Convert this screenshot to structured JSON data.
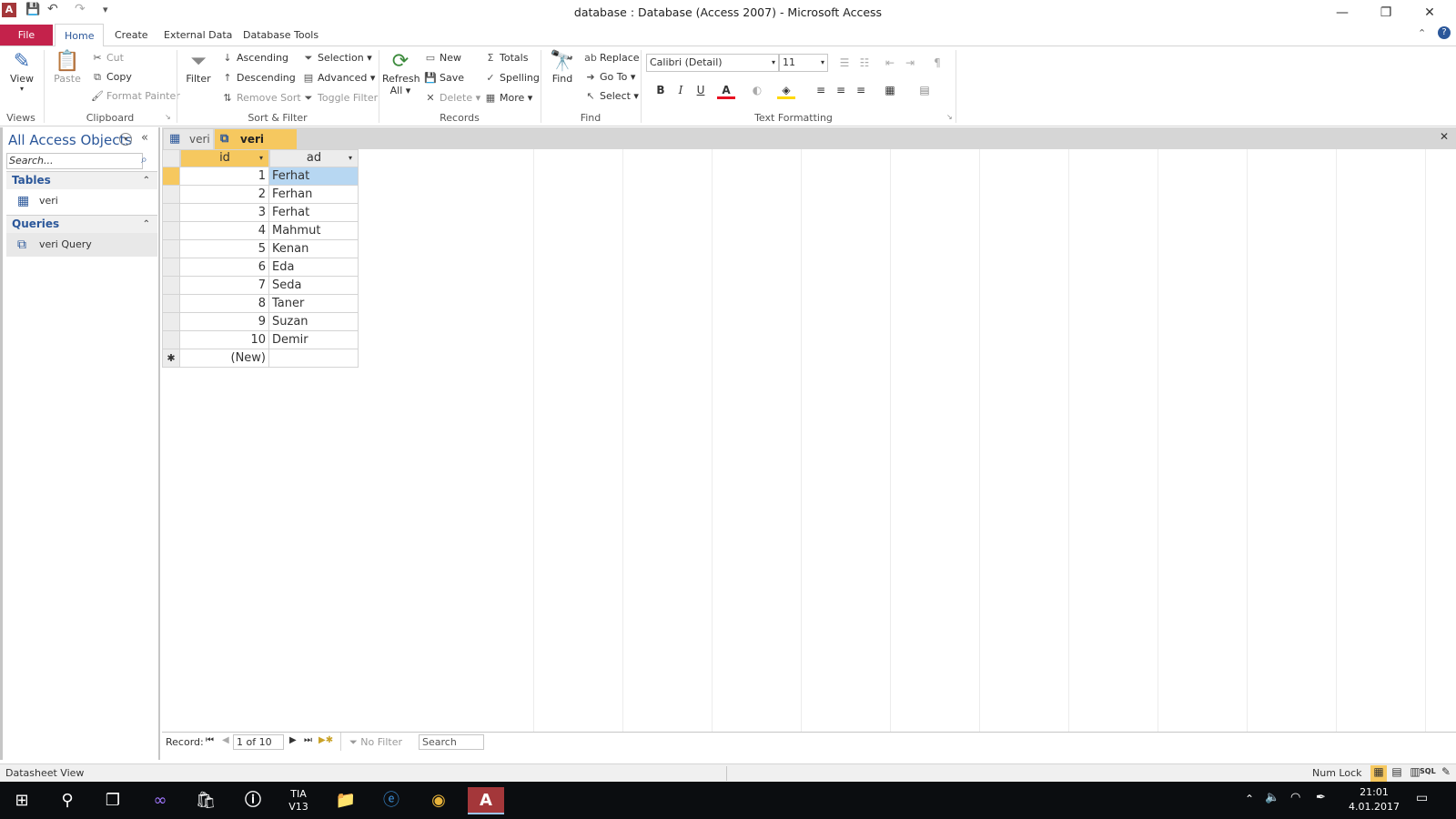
{
  "window": {
    "title": "database : Database (Access 2007)  -  Microsoft Access",
    "qat": {
      "save": "💾",
      "undo": "↶",
      "redo": "↷",
      "customize": "▾"
    },
    "minimize": "—",
    "restore": "❐",
    "close": "✕"
  },
  "ribbon_tabs": [
    "File",
    "Home",
    "Create",
    "External Data",
    "Database Tools"
  ],
  "ribbon": {
    "views": {
      "view_label": "View",
      "group": "Views"
    },
    "clipboard": {
      "paste": "Paste",
      "cut": "Cut",
      "copy": "Copy",
      "format_painter": "Format Painter",
      "group": "Clipboard"
    },
    "sort_filter": {
      "filter": "Filter",
      "ascending": "Ascending",
      "descending": "Descending",
      "remove_sort": "Remove Sort",
      "selection": "Selection",
      "advanced": "Advanced",
      "toggle_filter": "Toggle Filter",
      "group": "Sort & Filter"
    },
    "records": {
      "refresh_all": "Refresh",
      "refresh_all2": "All",
      "new": "New",
      "save": "Save",
      "delete": "Delete",
      "totals": "Totals",
      "spelling": "Spelling",
      "more": "More",
      "group": "Records"
    },
    "find": {
      "find": "Find",
      "replace": "Replace",
      "goto": "Go To",
      "select": "Select",
      "group": "Find"
    },
    "text_formatting": {
      "font": "Calibri (Detail)",
      "size": "11",
      "bold": "B",
      "italic": "I",
      "underline": "U",
      "group": "Text Formatting",
      "font_color": "#e81123",
      "highlight_color": "#ffd800"
    }
  },
  "nav_pane": {
    "title": "All Access Objects",
    "search_placeholder": "Search...",
    "sections": [
      {
        "header": "Tables",
        "items": [
          "veri"
        ]
      },
      {
        "header": "Queries",
        "items": [
          "veri Query"
        ]
      }
    ]
  },
  "doc_tabs": [
    "veri",
    "veri Query"
  ],
  "datasheet": {
    "columns": [
      "id",
      "ad"
    ],
    "rows": [
      {
        "id": "1",
        "ad": "Ferhat"
      },
      {
        "id": "2",
        "ad": "Ferhan"
      },
      {
        "id": "3",
        "ad": "Ferhat"
      },
      {
        "id": "4",
        "ad": "Mahmut"
      },
      {
        "id": "5",
        "ad": "Kenan"
      },
      {
        "id": "6",
        "ad": "Eda"
      },
      {
        "id": "7",
        "ad": "Seda"
      },
      {
        "id": "8",
        "ad": "Taner"
      },
      {
        "id": "9",
        "ad": "Suzan"
      },
      {
        "id": "10",
        "ad": "Demir"
      }
    ],
    "new_row_label": "(New)",
    "new_row_marker": "✱"
  },
  "record_nav": {
    "label": "Record:",
    "position": "1 of 10",
    "filter": "No Filter",
    "search": "Search"
  },
  "status": {
    "left": "Datasheet View",
    "numlock": "Num Lock"
  },
  "taskbar": {
    "time": "21:01",
    "date": "4.01.2017",
    "apps": [
      "TIA V13"
    ]
  }
}
